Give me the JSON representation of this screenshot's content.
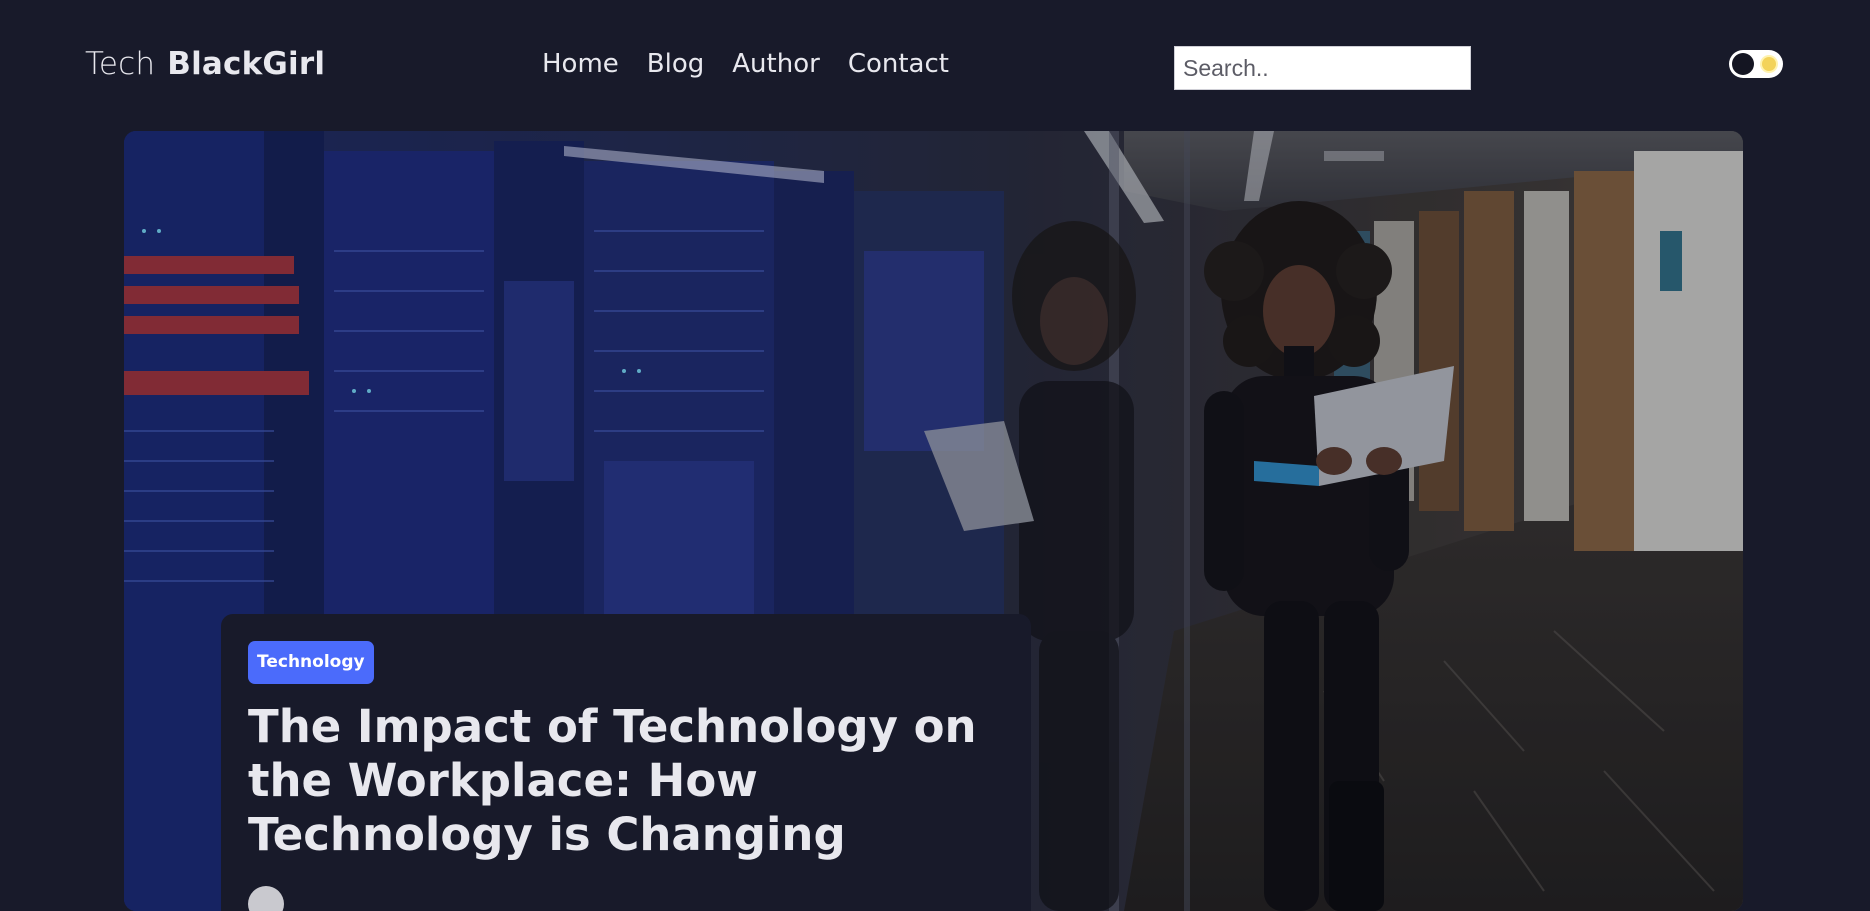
{
  "header": {
    "logo_light": "Tech",
    "logo_bold": "BlackGirl",
    "nav": [
      {
        "label": "Home"
      },
      {
        "label": "Blog"
      },
      {
        "label": "Author"
      },
      {
        "label": "Contact"
      }
    ],
    "search_placeholder": "Search.."
  },
  "theme": {
    "background": "#181a2a",
    "accent": "#4b6bfb",
    "text": "#e8e8ee"
  },
  "hero": {
    "category": "Technology",
    "title": "The Impact of Technology on the Workplace: How Technology is Changing"
  },
  "icons": {
    "toggle": "theme-toggle-icon",
    "author_avatar": "avatar"
  }
}
